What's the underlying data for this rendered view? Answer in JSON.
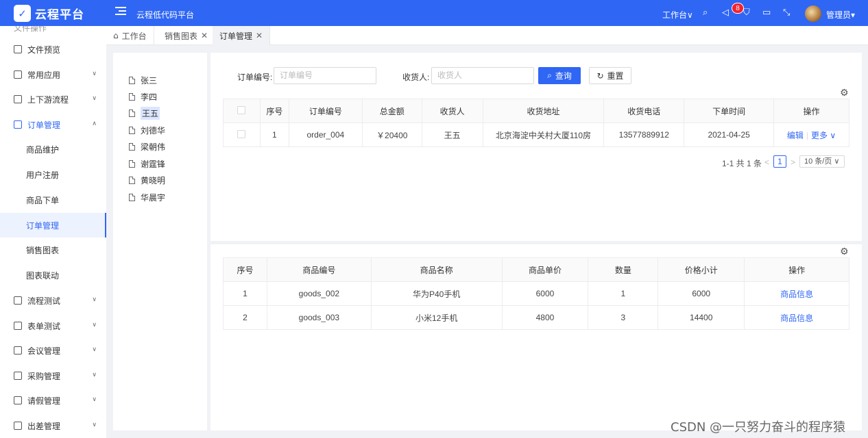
{
  "app": {
    "logo_glyph": "✓",
    "name": "云程平台",
    "subtitle": "云程低代码平台"
  },
  "header": {
    "workspace": "工作台∨",
    "notice_count": "8",
    "user": "管理员▾"
  },
  "sidebar": {
    "cut_item": "文件操作",
    "items": [
      {
        "label": "文件预览",
        "chev": ""
      },
      {
        "label": "常用应用",
        "chev": "∨"
      },
      {
        "label": "上下游流程",
        "chev": "∨"
      },
      {
        "label": "订单管理",
        "chev": "∧"
      },
      {
        "label": "商品维护",
        "chev": ""
      },
      {
        "label": "用户注册",
        "chev": ""
      },
      {
        "label": "商品下单",
        "chev": ""
      },
      {
        "label": "订单管理",
        "chev": ""
      },
      {
        "label": "销售图表",
        "chev": ""
      },
      {
        "label": "图表联动",
        "chev": ""
      },
      {
        "label": "流程测试",
        "chev": "∨"
      },
      {
        "label": "表单测试",
        "chev": "∨"
      },
      {
        "label": "会议管理",
        "chev": "∨"
      },
      {
        "label": "采购管理",
        "chev": "∨"
      },
      {
        "label": "请假管理",
        "chev": "∨"
      },
      {
        "label": "出差管理",
        "chev": "∨"
      }
    ]
  },
  "tabs": [
    {
      "label": "工作台",
      "close": ""
    },
    {
      "label": "销售图表",
      "close": "✕"
    },
    {
      "label": "订单管理",
      "close": "✕"
    }
  ],
  "tree": [
    "张三",
    "李四",
    "王五",
    "刘德华",
    "梁朝伟",
    "谢霆锋",
    "黄晓明",
    "华晨宇"
  ],
  "search": {
    "order_label": "订单编号:",
    "order_placeholder": "订单编号",
    "receiver_label": "收货人:",
    "receiver_placeholder": "收货人",
    "query": "查询",
    "reset": "重置"
  },
  "orders": {
    "columns": [
      "序号",
      "订单编号",
      "总金额",
      "收货人",
      "收货地址",
      "收货电话",
      "下单时间",
      "操作"
    ],
    "rows": [
      {
        "no": "1",
        "order_no": "order_004",
        "amount": "￥20400",
        "receiver": "王五",
        "address": "北京海淀中关村大厦110房",
        "phone": "13577889912",
        "date": "2021-04-25",
        "edit": "编辑",
        "more": "更多 ∨"
      }
    ]
  },
  "pager": {
    "summary": "1-1 共 1 条",
    "prev": "<",
    "current": "1",
    "next": ">",
    "size": "10 条/页 ∨"
  },
  "items": {
    "columns": [
      "序号",
      "商品编号",
      "商品名称",
      "商品单价",
      "数量",
      "价格小计",
      "操作"
    ],
    "rows": [
      {
        "no": "1",
        "code": "goods_002",
        "name": "华为P40手机",
        "price": "6000",
        "qty": "1",
        "subtotal": "6000",
        "action": "商品信息"
      },
      {
        "no": "2",
        "code": "goods_003",
        "name": "小米12手机",
        "price": "4800",
        "qty": "3",
        "subtotal": "14400",
        "action": "商品信息"
      }
    ]
  },
  "watermark": "CSDN @一只努力奋斗的程序猿"
}
